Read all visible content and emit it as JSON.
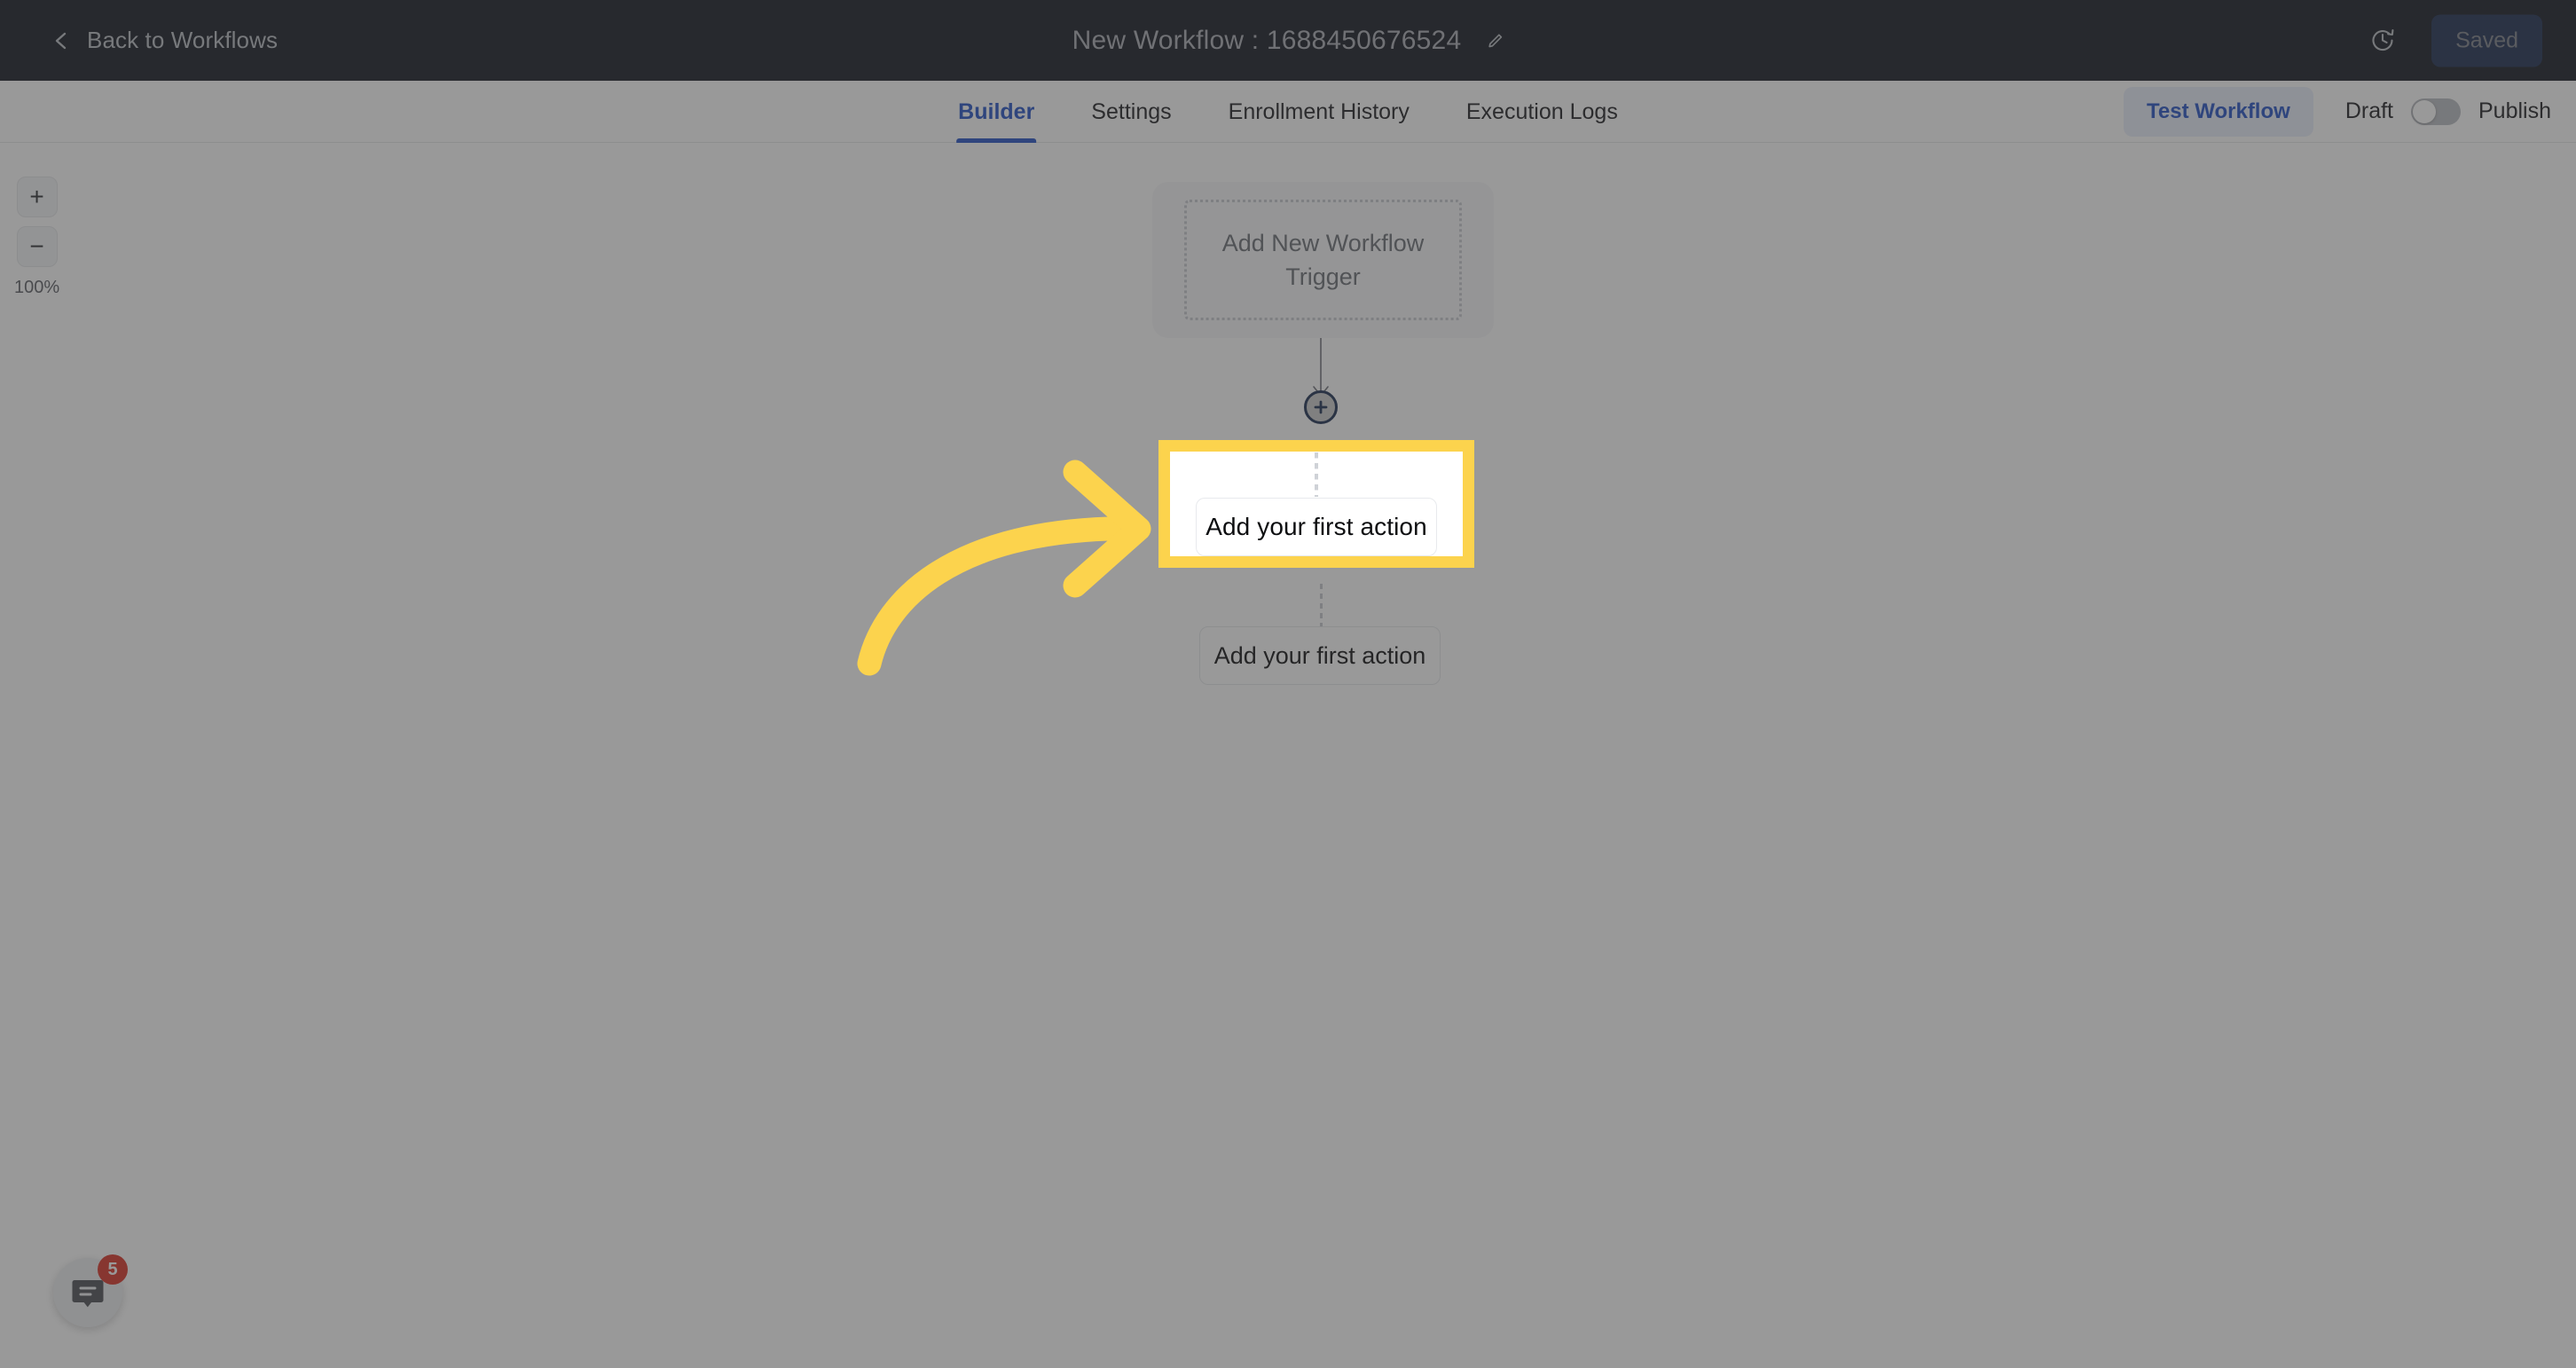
{
  "topbar": {
    "back_label": "Back to Workflows",
    "back_icon": "chevron-left-icon",
    "workflow_title": "New Workflow : 1688450676524",
    "edit_icon": "pencil-icon",
    "history_icon": "clock-history-icon",
    "save_status_label": "Saved"
  },
  "tabbar": {
    "tabs": [
      {
        "label": "Builder",
        "active": true
      },
      {
        "label": "Settings",
        "active": false
      },
      {
        "label": "Enrollment History",
        "active": false
      },
      {
        "label": "Execution Logs",
        "active": false
      }
    ],
    "test_workflow_label": "Test Workflow",
    "draft_label": "Draft",
    "publish_label": "Publish",
    "toggle_state": "draft"
  },
  "canvas": {
    "zoom_in_label": "+",
    "zoom_out_label": "−",
    "zoom_level": "100%",
    "trigger_node_label": "Add New Workflow Trigger",
    "add_action_label": "Add your first action",
    "plus_node_icon": "plus-circle-icon"
  },
  "spotlight": {
    "action_label": "Add your first action",
    "border_color": "#FCD34D"
  },
  "annotation": {
    "arrow_icon": "curved-arrow-right-icon",
    "arrow_color": "#FCD34D"
  },
  "chat_widget": {
    "icon": "chat-bubble-icon",
    "badge_count": "5",
    "badge_color": "#D93025"
  },
  "colors": {
    "topbar_bg": "#111620",
    "accent_blue": "#2251C4",
    "highlight_yellow": "#FCD34D",
    "dim_overlay": "rgba(60,60,60,0.52)"
  }
}
